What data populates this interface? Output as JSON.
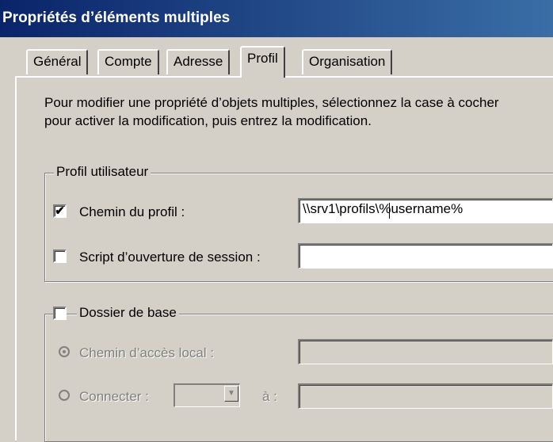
{
  "window": {
    "title": "Propriétés d’éléments multiples"
  },
  "tabs": [
    {
      "label": "Général",
      "active": false
    },
    {
      "label": "Compte",
      "active": false
    },
    {
      "label": "Adresse",
      "active": false
    },
    {
      "label": "Profil",
      "active": true
    },
    {
      "label": "Organisation",
      "active": false
    }
  ],
  "description": {
    "line1": "Pour modifier une propriété d’objets multiples, sélectionnez la case à cocher",
    "line2": "pour activer la modification, puis entrez la modification."
  },
  "profile_group": {
    "legend": "Profil utilisateur",
    "profile_path": {
      "label": "Chemin du profil :",
      "checked": true,
      "check_glyph": "✔",
      "value": "\\\\srv1\\profils\\%username%"
    },
    "logon_script": {
      "label": "Script d’ouverture de session :",
      "checked": false,
      "value": ""
    }
  },
  "home_group": {
    "legend": "Dossier de base",
    "checked": false,
    "local_path": {
      "label": "Chemin d’accès local :",
      "selected": true,
      "value": ""
    },
    "connect": {
      "label": "Connecter :",
      "selected": false,
      "to_label": "à :",
      "drive": "",
      "value": ""
    }
  }
}
